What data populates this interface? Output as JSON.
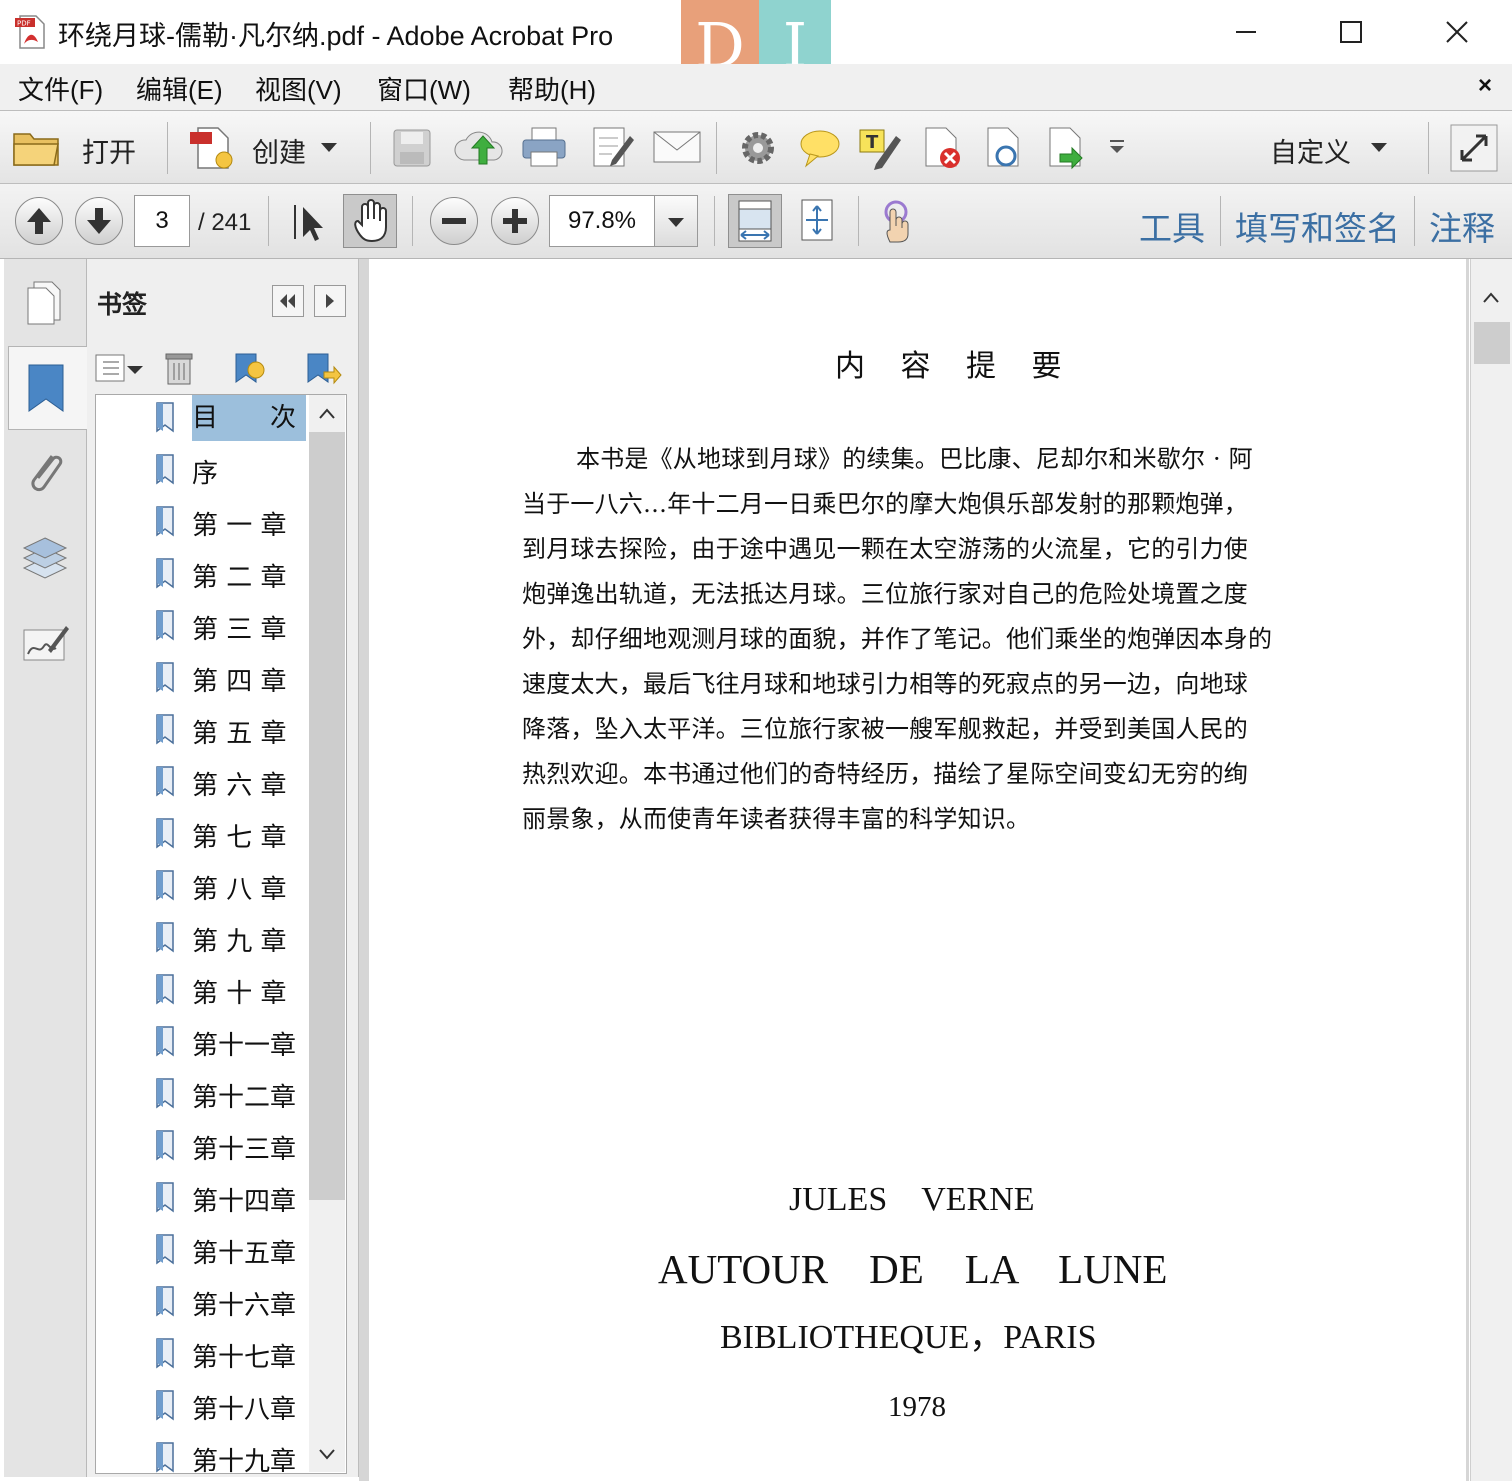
{
  "window": {
    "title": "环绕月球-儒勒·凡尔纳.pdf - Adobe Acrobat Pro",
    "logo_left": "D",
    "logo_right": "I"
  },
  "menu": {
    "items": [
      "文件(F)",
      "编辑(E)",
      "视图(V)",
      "窗口(W)",
      "帮助(H)"
    ],
    "close": "×"
  },
  "toolbar": {
    "open_label": "打开",
    "create_label": "创建",
    "customize_label": "自定义"
  },
  "nav": {
    "current_page": "3",
    "total_pages": "/ 241",
    "zoom": "97.8%",
    "tools_link": "工具",
    "sign_link": "填写和签名",
    "comment_link": "注释"
  },
  "bookmarks": {
    "title": "书签",
    "items": [
      "目　　次",
      "序",
      "第 一 章",
      "第 二 章",
      "第 三 章",
      "第 四 章",
      "第 五 章",
      "第 六 章",
      "第 七 章",
      " 第 八 章",
      "第 九 章",
      "第 十 章",
      "第十一章",
      "第十二章",
      "第十三章",
      "第十四章",
      "第十五章",
      "第十六章",
      "第十七章",
      "第十八章",
      "第十九章"
    ],
    "selected_index": 0
  },
  "document": {
    "heading": "内 容 提 要",
    "paragraph_lines": [
      "本书是《从地球到月球》的续集。巴比康、尼却尔和米歇尔 · 阿",
      "当于一八六…年十二月一日乘巴尔的摩大炮俱乐部发射的那颗炮弹，",
      "到月球去探险，由于途中遇见一颗在太空游荡的火流星，它的引力使",
      "炮弹逸出轨道，无法抵达月球。三位旅行家对自己的危险处境置之度",
      "外，却仔细地观测月球的面貌，并作了笔记。他们乘坐的炮弹因本身的",
      "速度太大，最后飞往月球和地球引力相等的死寂点的另一边，向地球",
      "降落，坠入太平洋。三位旅行家被一艘军舰救起，并受到美国人民的",
      "热烈欢迎。本书通过他们的奇特经历，描绘了星际空间变幻无穷的绚",
      "丽景象，从而使青年读者获得丰富的科学知识。"
    ],
    "author": "JULES　VERNE",
    "book_title": "AUTOUR　DE　LA　LUNE",
    "publisher": "BIBLIOTHEQUE，PARIS",
    "year": "1978"
  }
}
